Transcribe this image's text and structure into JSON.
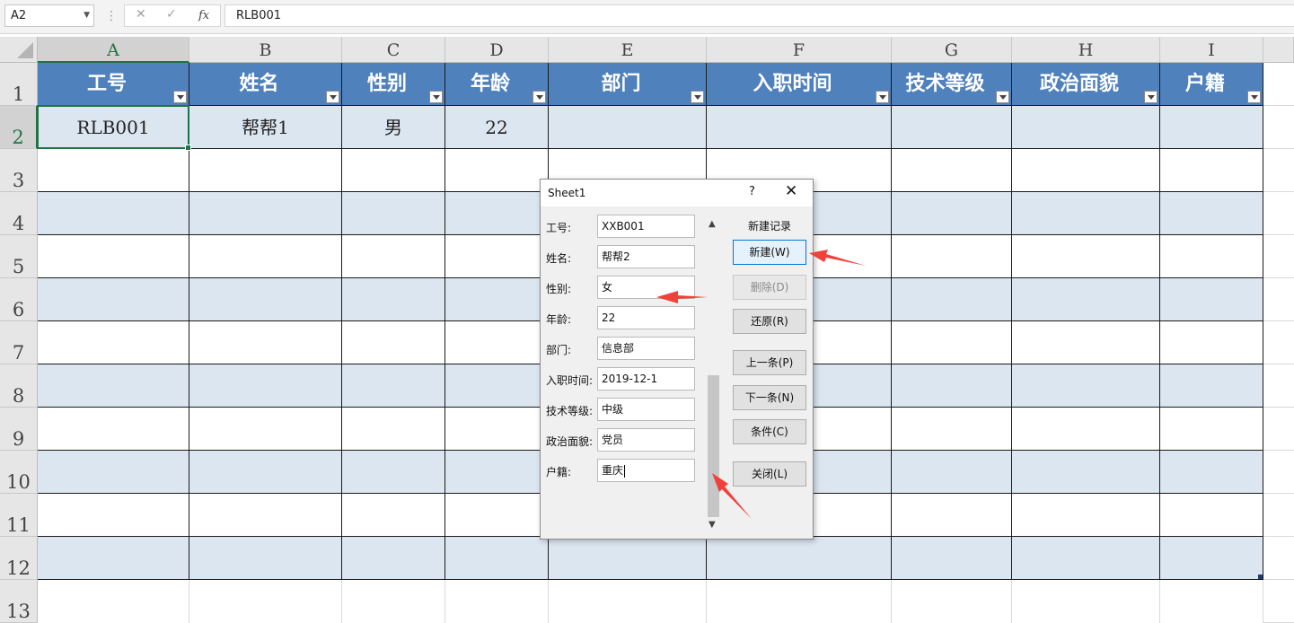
{
  "formula_bar": {
    "name_box": "A2",
    "fx": "fx",
    "content": "RLB001"
  },
  "columns": [
    "A",
    "B",
    "C",
    "D",
    "E",
    "F",
    "G",
    "H",
    "I"
  ],
  "rows": [
    "1",
    "2",
    "3",
    "4",
    "5",
    "6",
    "7",
    "8",
    "9",
    "10",
    "11",
    "12",
    "13"
  ],
  "table": {
    "headers": [
      "工号",
      "姓名",
      "性别",
      "年龄",
      "部门",
      "入职时间",
      "技术等级",
      "政治面貌",
      "户籍"
    ],
    "row2": [
      "RLB001",
      "帮帮1",
      "男",
      "22",
      "",
      "",
      "",
      "",
      ""
    ]
  },
  "dialog": {
    "title": "Sheet1",
    "help": "?",
    "close": "✕",
    "record_label": "新建记录",
    "fields": [
      {
        "label": "工号:",
        "value": "XXB001"
      },
      {
        "label": "姓名:",
        "value": "帮帮2"
      },
      {
        "label": "性别:",
        "value": "女"
      },
      {
        "label": "年龄:",
        "value": "22"
      },
      {
        "label": "部门:",
        "value": "信息部"
      },
      {
        "label": "入职时间:",
        "value": "2019-12-1"
      },
      {
        "label": "技术等级:",
        "value": "中级"
      },
      {
        "label": "政治面貌:",
        "value": "党员"
      },
      {
        "label": "户籍:",
        "value": "重庆"
      }
    ],
    "buttons": {
      "new": "新建(W)",
      "delete": "删除(D)",
      "restore": "还原(R)",
      "prev": "上一条(P)",
      "next": "下一条(N)",
      "criteria": "条件(C)",
      "close": "关闭(L)"
    }
  },
  "colors": {
    "header_fill": "#4f81bd",
    "band_fill": "#dce6f1",
    "selection": "#217346",
    "annotation_arrow": "#f0413c"
  }
}
